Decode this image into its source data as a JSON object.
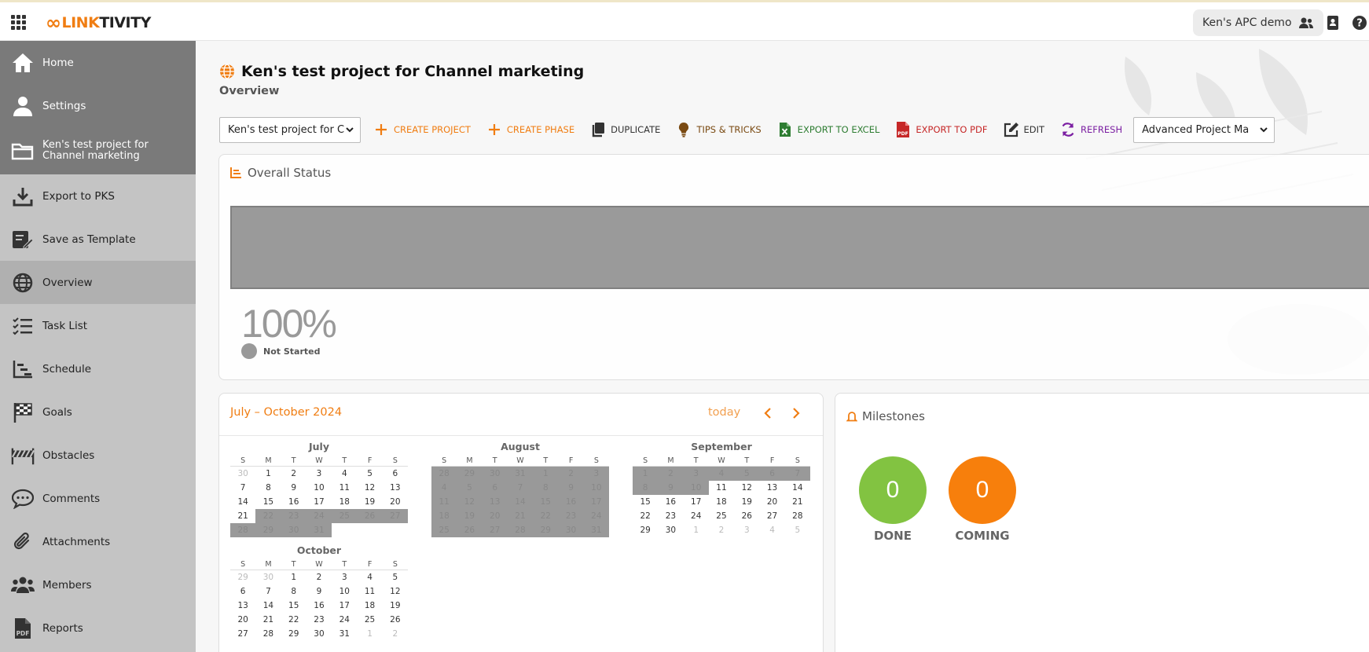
{
  "topbar": {
    "logo_prefix": "LINK",
    "logo_suffix": "TIVITY",
    "workspace_label": "Ken's APC demo"
  },
  "sidebar": {
    "items": [
      {
        "label": "Home",
        "icon": "home-icon"
      },
      {
        "label": "Settings",
        "icon": "user-icon"
      },
      {
        "label": "Ken's test project for Channel marketing",
        "icon": "folder-icon"
      },
      {
        "label": "Export to PKS",
        "icon": "download-icon"
      },
      {
        "label": "Save as Template",
        "icon": "save-template-icon"
      },
      {
        "label": "Overview",
        "icon": "globe-icon"
      },
      {
        "label": "Task List",
        "icon": "task-list-icon"
      },
      {
        "label": "Schedule",
        "icon": "schedule-icon"
      },
      {
        "label": "Goals",
        "icon": "flag-icon"
      },
      {
        "label": "Obstacles",
        "icon": "barrier-icon"
      },
      {
        "label": "Comments",
        "icon": "comment-icon"
      },
      {
        "label": "Attachments",
        "icon": "paperclip-icon"
      },
      {
        "label": "Members",
        "icon": "members-icon"
      },
      {
        "label": "Reports",
        "icon": "pdf-icon"
      }
    ]
  },
  "main": {
    "title": "Ken's test project for Channel marketing",
    "subtitle": "Overview"
  },
  "toolbar": {
    "project_select": "Ken's test project for C",
    "create_project": "CREATE PROJECT",
    "create_phase": "CREATE PHASE",
    "duplicate": "DUPLICATE",
    "tips": "TIPS & TRICKS",
    "export_excel": "EXPORT TO EXCEL",
    "export_pdf": "EXPORT TO PDF",
    "edit": "EDIT",
    "refresh": "REFRESH",
    "template_select": "Advanced Project Ma"
  },
  "status": {
    "title": "Overall Status",
    "percent": "100%",
    "legend": "Not Started"
  },
  "calendar": {
    "range": "July – October 2024",
    "today": "today",
    "dow": [
      "S",
      "M",
      "T",
      "W",
      "T",
      "F",
      "S"
    ],
    "months": [
      {
        "name": "July",
        "days": [
          "30",
          "1",
          "2",
          "3",
          "4",
          "5",
          "6",
          "7",
          "8",
          "9",
          "10",
          "11",
          "12",
          "13",
          "14",
          "15",
          "16",
          "17",
          "18",
          "19",
          "20",
          "21",
          "22",
          "23",
          "24",
          "25",
          "26",
          "27",
          "28",
          "29",
          "30",
          "31",
          "",
          "",
          ""
        ]
      },
      {
        "name": "August",
        "days": [
          "28",
          "29",
          "30",
          "31",
          "1",
          "2",
          "3",
          "4",
          "5",
          "6",
          "7",
          "8",
          "9",
          "10",
          "11",
          "12",
          "13",
          "14",
          "15",
          "16",
          "17",
          "18",
          "19",
          "20",
          "21",
          "22",
          "23",
          "24",
          "25",
          "26",
          "27",
          "28",
          "29",
          "30",
          "31"
        ]
      },
      {
        "name": "September",
        "days": [
          "1",
          "2",
          "3",
          "4",
          "5",
          "6",
          "7",
          "8",
          "9",
          "10",
          "11",
          "12",
          "13",
          "14",
          "15",
          "16",
          "17",
          "18",
          "19",
          "20",
          "21",
          "22",
          "23",
          "24",
          "25",
          "26",
          "27",
          "28",
          "29",
          "30",
          "1",
          "2",
          "3",
          "4",
          "5"
        ]
      },
      {
        "name": "October",
        "days": [
          "29",
          "30",
          "1",
          "2",
          "3",
          "4",
          "5",
          "6",
          "7",
          "8",
          "9",
          "10",
          "11",
          "12",
          "13",
          "14",
          "15",
          "16",
          "17",
          "18",
          "19",
          "20",
          "21",
          "22",
          "23",
          "24",
          "25",
          "26",
          "27",
          "28",
          "29",
          "30",
          "31",
          "1",
          "2"
        ]
      }
    ]
  },
  "milestones": {
    "title": "Milestones",
    "done_count": "0",
    "done_label": "DONE",
    "coming_count": "0",
    "coming_label": "COMING"
  },
  "colors": {
    "accent": "#f07d12",
    "done": "#82c341",
    "coming": "#f77f0c",
    "excel": "#2e7d32",
    "pdf": "#c62828",
    "refresh": "#7b1fa2"
  }
}
